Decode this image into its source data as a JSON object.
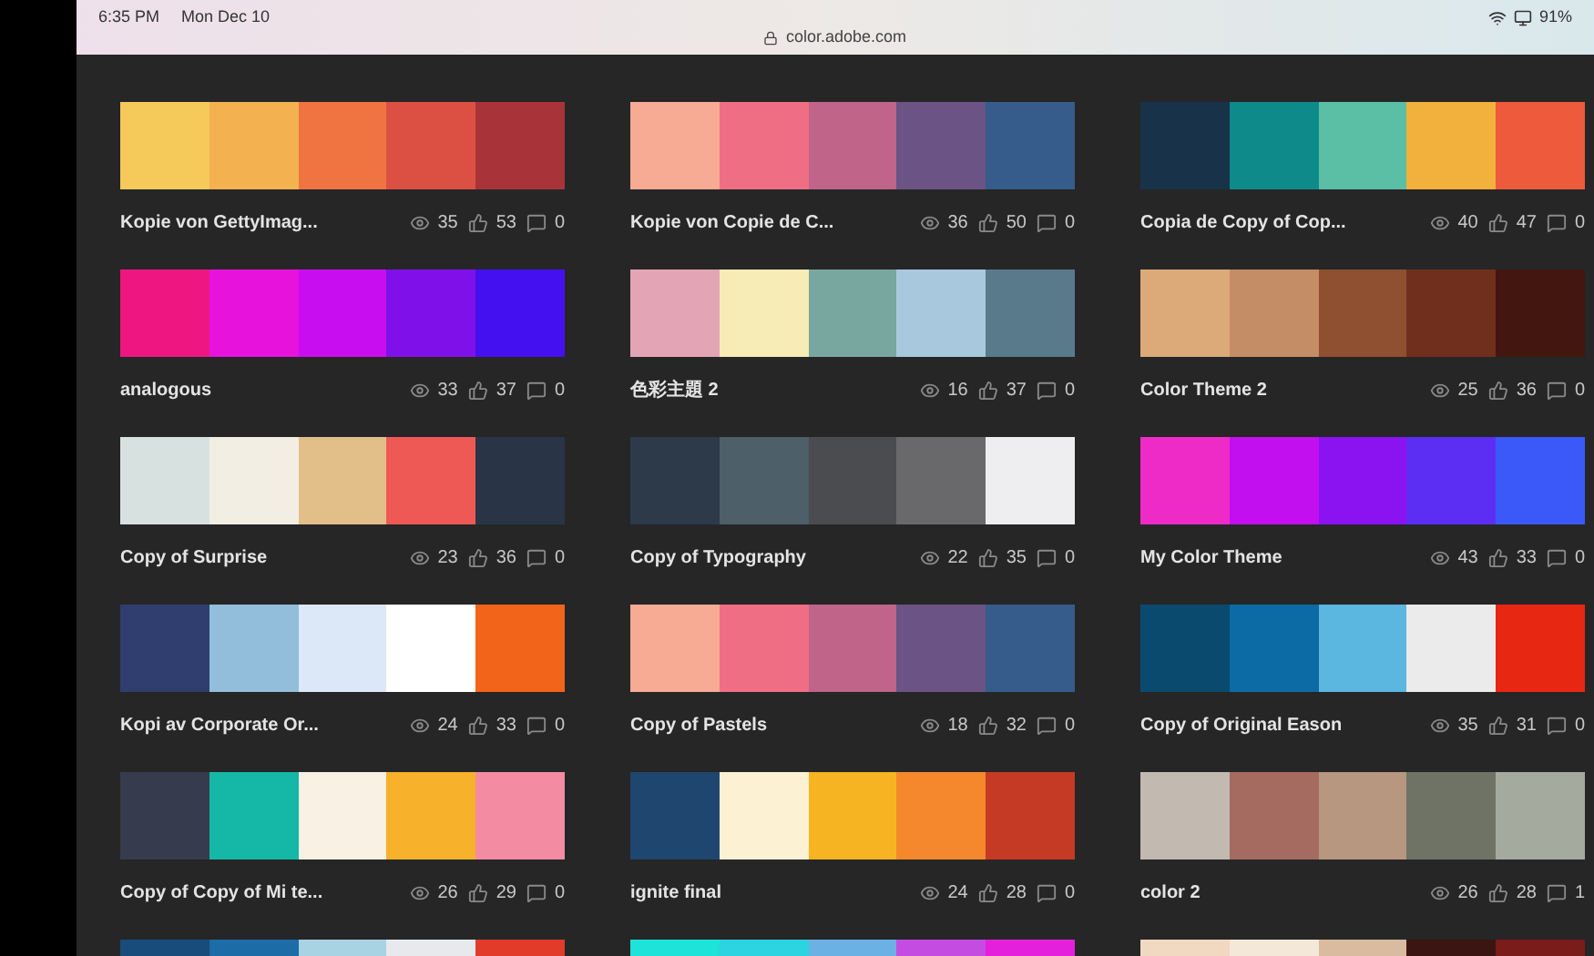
{
  "status_bar": {
    "time": "6:35 PM",
    "date": "Mon Dec 10",
    "url": "color.adobe.com",
    "battery": "91%"
  },
  "themes": [
    {
      "swatches": [
        {
          "color": "#f5c95a"
        },
        {
          "color": "#f3b14f"
        },
        {
          "color": "#ef7442"
        },
        {
          "color": "#dc5043"
        },
        {
          "color": "#a8343a"
        }
      ],
      "title": "Kopie von GettyImag...",
      "views": "35",
      "likes": "53",
      "comments": "0"
    },
    {
      "swatches": [
        {
          "color": "#f7aa94"
        },
        {
          "color": "#f06e84"
        },
        {
          "color": "#c0648a"
        },
        {
          "color": "#6c5385"
        },
        {
          "color": "#355c8a"
        }
      ],
      "title": "Kopie von Copie de C...",
      "views": "36",
      "likes": "50",
      "comments": "0"
    },
    {
      "swatches": [
        {
          "color": "#183349"
        },
        {
          "color": "#0f8a8b"
        },
        {
          "color": "#5bbfa6"
        },
        {
          "color": "#f2b13c"
        },
        {
          "color": "#ee5a3c"
        }
      ],
      "title": "Copia de Copy of Cop...",
      "views": "40",
      "likes": "47",
      "comments": "0"
    },
    {
      "swatches": [
        {
          "color": "#ee1782"
        },
        {
          "color": "#e713dc"
        },
        {
          "color": "#c80ef0"
        },
        {
          "color": "#8010ea"
        },
        {
          "color": "#4510f0"
        }
      ],
      "title": "analogous",
      "views": "33",
      "likes": "37",
      "comments": "0"
    },
    {
      "swatches": [
        {
          "color": "#e3a5b5"
        },
        {
          "color": "#f7ecb6"
        },
        {
          "color": "#77a79e"
        },
        {
          "color": "#a8c9dd"
        },
        {
          "color": "#587a8b"
        }
      ],
      "title": "色彩主題 2",
      "views": "16",
      "likes": "37",
      "comments": "0"
    },
    {
      "swatches": [
        {
          "color": "#dbaa78"
        },
        {
          "color": "#c58d65"
        },
        {
          "color": "#8e5030"
        },
        {
          "color": "#6f2f1c"
        },
        {
          "color": "#431710"
        }
      ],
      "title": "Color Theme 2",
      "views": "25",
      "likes": "36",
      "comments": "0"
    },
    {
      "swatches": [
        {
          "color": "#d7e2e0"
        },
        {
          "color": "#f2eee3"
        },
        {
          "color": "#e2bf88"
        },
        {
          "color": "#ef5955"
        },
        {
          "color": "#293546"
        }
      ],
      "title": "Copy of Surprise",
      "views": "23",
      "likes": "36",
      "comments": "0"
    },
    {
      "swatches": [
        {
          "color": "#2c3a4a"
        },
        {
          "color": "#4d5f69"
        },
        {
          "color": "#4b4c50"
        },
        {
          "color": "#69696c"
        },
        {
          "color": "#eeedf0"
        }
      ],
      "title": "Copy of Typography",
      "views": "22",
      "likes": "35",
      "comments": "0"
    },
    {
      "swatches": [
        {
          "color": "#ee2bc7"
        },
        {
          "color": "#c20ff0"
        },
        {
          "color": "#8b13f2"
        },
        {
          "color": "#5c2ef3"
        },
        {
          "color": "#3a59f8"
        }
      ],
      "title": "My Color Theme",
      "views": "43",
      "likes": "33",
      "comments": "0"
    },
    {
      "swatches": [
        {
          "color": "#2f3e6e"
        },
        {
          "color": "#93bedb"
        },
        {
          "color": "#dce8f7"
        },
        {
          "color": "#ffffff"
        },
        {
          "color": "#f26419"
        }
      ],
      "title": "Kopi av Corporate Or...",
      "views": "24",
      "likes": "33",
      "comments": "0"
    },
    {
      "swatches": [
        {
          "color": "#f7aa94"
        },
        {
          "color": "#f06e84"
        },
        {
          "color": "#c0648a"
        },
        {
          "color": "#6c5385"
        },
        {
          "color": "#355c8a"
        }
      ],
      "title": "Copy of Pastels",
      "views": "18",
      "likes": "32",
      "comments": "0"
    },
    {
      "swatches": [
        {
          "color": "#0b4a6f"
        },
        {
          "color": "#0c6ba4"
        },
        {
          "color": "#5bb6e0"
        },
        {
          "color": "#ebebeb"
        },
        {
          "color": "#e82712"
        }
      ],
      "title": "Copy of Original Eason",
      "views": "35",
      "likes": "31",
      "comments": "0"
    },
    {
      "swatches": [
        {
          "color": "#363c4d"
        },
        {
          "color": "#15b8a6"
        },
        {
          "color": "#f9f2e4"
        },
        {
          "color": "#f8b12a"
        },
        {
          "color": "#f38ca3"
        }
      ],
      "title": "Copy of Copy of Mi te...",
      "views": "26",
      "likes": "29",
      "comments": "0"
    },
    {
      "swatches": [
        {
          "color": "#1f466e"
        },
        {
          "color": "#fcf1d3"
        },
        {
          "color": "#f6b423"
        },
        {
          "color": "#f5882d"
        },
        {
          "color": "#c53a24"
        }
      ],
      "title": "ignite final",
      "views": "24",
      "likes": "28",
      "comments": "0"
    },
    {
      "swatches": [
        {
          "color": "#c2b9b0"
        },
        {
          "color": "#a66b60"
        },
        {
          "color": "#b7977f"
        },
        {
          "color": "#6f7366"
        },
        {
          "color": "#a4aa9d"
        }
      ],
      "title": "color 2",
      "views": "26",
      "likes": "28",
      "comments": "1"
    },
    {
      "swatches": [
        {
          "color": "#184c7a"
        },
        {
          "color": "#1c6ca8"
        },
        {
          "color": "#a8d3e3"
        },
        {
          "color": "#e7e9ec"
        },
        {
          "color": "#e23b2a"
        }
      ]
    },
    {
      "swatches": [
        {
          "color": "#1ee3d8"
        },
        {
          "color": "#2bd4e0"
        },
        {
          "color": "#6bb1e4"
        },
        {
          "color": "#c54ce0"
        },
        {
          "color": "#e520dd"
        }
      ]
    },
    {
      "swatches": [
        {
          "color": "#f1d8c0"
        },
        {
          "color": "#f4e8d8"
        },
        {
          "color": "#d9bba0"
        },
        {
          "color": "#3a1512"
        },
        {
          "color": "#7a1c1a"
        }
      ]
    }
  ]
}
